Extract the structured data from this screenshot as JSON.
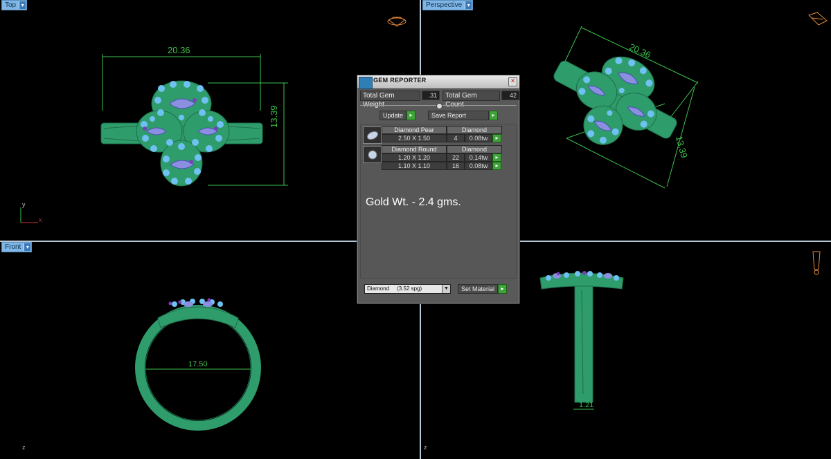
{
  "viewports": {
    "top": {
      "label": "Top",
      "dim_width": "20.36",
      "dim_height": "13.39",
      "axis_y": "y",
      "axis_x": "x"
    },
    "perspective": {
      "label": "Perspective",
      "dim_width": "20.36",
      "dim_height": "13.39"
    },
    "front": {
      "label": "Front",
      "dim_inner": "17.50",
      "axis_z": "z"
    },
    "right": {
      "dim_bottom": "1.21",
      "axis_z": "z"
    }
  },
  "gem_reporter": {
    "title": "GEM REPORTER",
    "total_weight_label": "Total Gem Weight",
    "total_weight_value": ".31",
    "total_count_label": "Total Gem Count",
    "total_count_value": "42",
    "update_label": "Update",
    "save_report_label": "Save Report",
    "groups": [
      {
        "shape": "Diamond Pear",
        "material": "Diamond",
        "rows": [
          {
            "size": "2.50 X 1.50",
            "count": "4",
            "weight": "0.08tw"
          }
        ]
      },
      {
        "shape": "Diamond Round",
        "material": "Diamond",
        "rows": [
          {
            "size": "1.20 X 1.20",
            "count": "22",
            "weight": "0.14tw"
          },
          {
            "size": "1.10 X 1.10",
            "count": "16",
            "weight": "0.08tw"
          }
        ]
      }
    ],
    "gold_weight": "Gold Wt. - 2.4 gms.",
    "material_select": "Diamond     (3.52 spg)",
    "set_material_label": "Set Material"
  },
  "colors": {
    "metal": "#2f9c6c",
    "metal_dark": "#1e6e4a",
    "gem_blue": "#6fc1f2",
    "gem_pear": "#8a8fe0",
    "gem_purple": "#7a3fc0",
    "dimension": "#3ec24b",
    "go_button": "#3fa33a"
  }
}
